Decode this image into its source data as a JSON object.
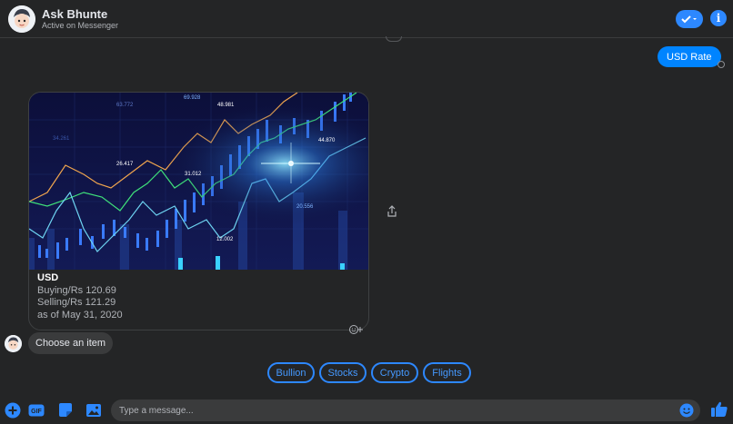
{
  "header": {
    "name": "Ask Bhunte",
    "status": "Active on Messenger"
  },
  "conversation": {
    "user_message": "USD Rate",
    "card": {
      "title": "USD",
      "buying": "Buying/Rs 120.69",
      "selling": "Selling/Rs 121.29",
      "date": "as of May 31, 2020",
      "image_labels": [
        "69.928",
        "63.772",
        "48.981",
        "44.870",
        "26.417",
        "31.012",
        "20.556",
        "12.002",
        "34.261"
      ]
    },
    "bot_message": "Choose an item",
    "quick_replies": [
      "Bullion",
      "Stocks",
      "Crypto",
      "Flights"
    ]
  },
  "composer": {
    "placeholder": "Type a message..."
  },
  "colors": {
    "accent": "#0084ff",
    "background": "#242526",
    "bubble_incoming": "#3a3b3c"
  }
}
